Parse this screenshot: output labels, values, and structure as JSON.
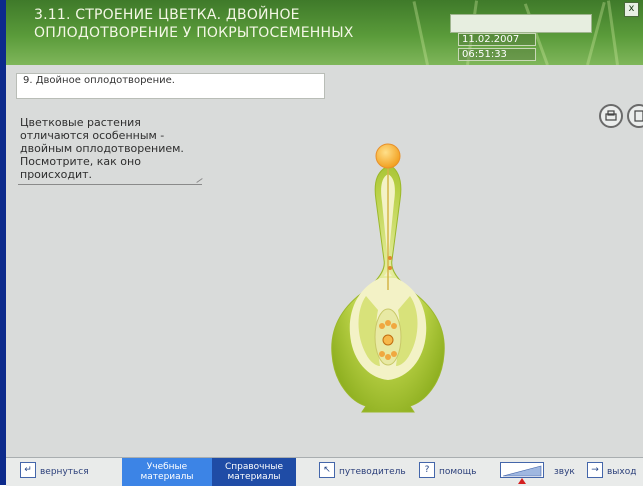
{
  "header": {
    "title": "3.11. СТРОЕНИЕ ЦВЕТКА. ДВОЙНОЕ ОПЛОДОТВОРЕНИЕ У ПОКРЫТОСЕМЕННЫХ",
    "date": "11.02.2007",
    "time": "06:51:33",
    "close_label": "x"
  },
  "step": {
    "label": "9. Двойное оплодотворение."
  },
  "description": {
    "text": "Цветковые растения отличаются особенным - двойным оплодотворением. Посмотрите, как оно происходит."
  },
  "bottom": {
    "back_label": "вернуться",
    "tab_study_label": "Учебные материалы",
    "tab_reference_label": "Справочные материалы",
    "guide_label": "путеводитель",
    "help_label": "помощь",
    "sound_label": "звук",
    "exit_label": "выход"
  },
  "icons": {
    "print": "printer-icon",
    "notes": "notes-icon"
  },
  "colors": {
    "header_green": "#4f8a33",
    "border_blue": "#0c2a8c",
    "tab_light_blue": "#3c84e6",
    "tab_dark_blue": "#1f4ca6",
    "flower_green": "#9cc02c"
  }
}
